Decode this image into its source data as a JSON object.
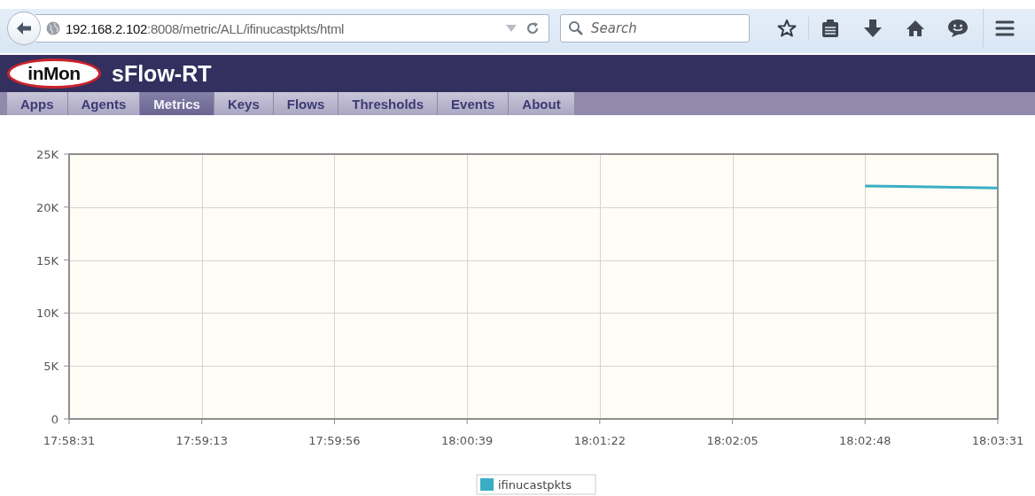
{
  "browser": {
    "url_host": "192.168.2.102",
    "url_path": ":8008/metric/ALL/ifinucastpkts/html",
    "search": {
      "placeholder": "Search"
    }
  },
  "header": {
    "logo": "inMon",
    "title": "sFlow-RT"
  },
  "tabs": [
    {
      "label": "Apps",
      "selected": false
    },
    {
      "label": "Agents",
      "selected": false
    },
    {
      "label": "Metrics",
      "selected": true
    },
    {
      "label": "Keys",
      "selected": false
    },
    {
      "label": "Flows",
      "selected": false
    },
    {
      "label": "Thresholds",
      "selected": false
    },
    {
      "label": "Events",
      "selected": false
    },
    {
      "label": "About",
      "selected": false
    }
  ],
  "chart": {
    "chart_data": {
      "type": "line",
      "series": [
        {
          "name": "ifinucastpkts",
          "color": "#3aaec4",
          "values": [
            null,
            null,
            null,
            null,
            null,
            null,
            22000,
            21800
          ]
        }
      ],
      "categories": [
        "17:58:31",
        "17:59:13",
        "17:59:56",
        "18:00:39",
        "18:01:22",
        "18:02:05",
        "18:02:48",
        "18:03:31"
      ],
      "ylim": [
        0,
        25000
      ],
      "grid": true,
      "yticks": [
        {
          "value": 0,
          "label": "0"
        },
        {
          "value": 5000,
          "label": "5K"
        },
        {
          "value": 10000,
          "label": "10K"
        },
        {
          "value": 15000,
          "label": "15K"
        },
        {
          "value": 20000,
          "label": "20K"
        },
        {
          "value": 25000,
          "label": "25K"
        }
      ]
    }
  }
}
